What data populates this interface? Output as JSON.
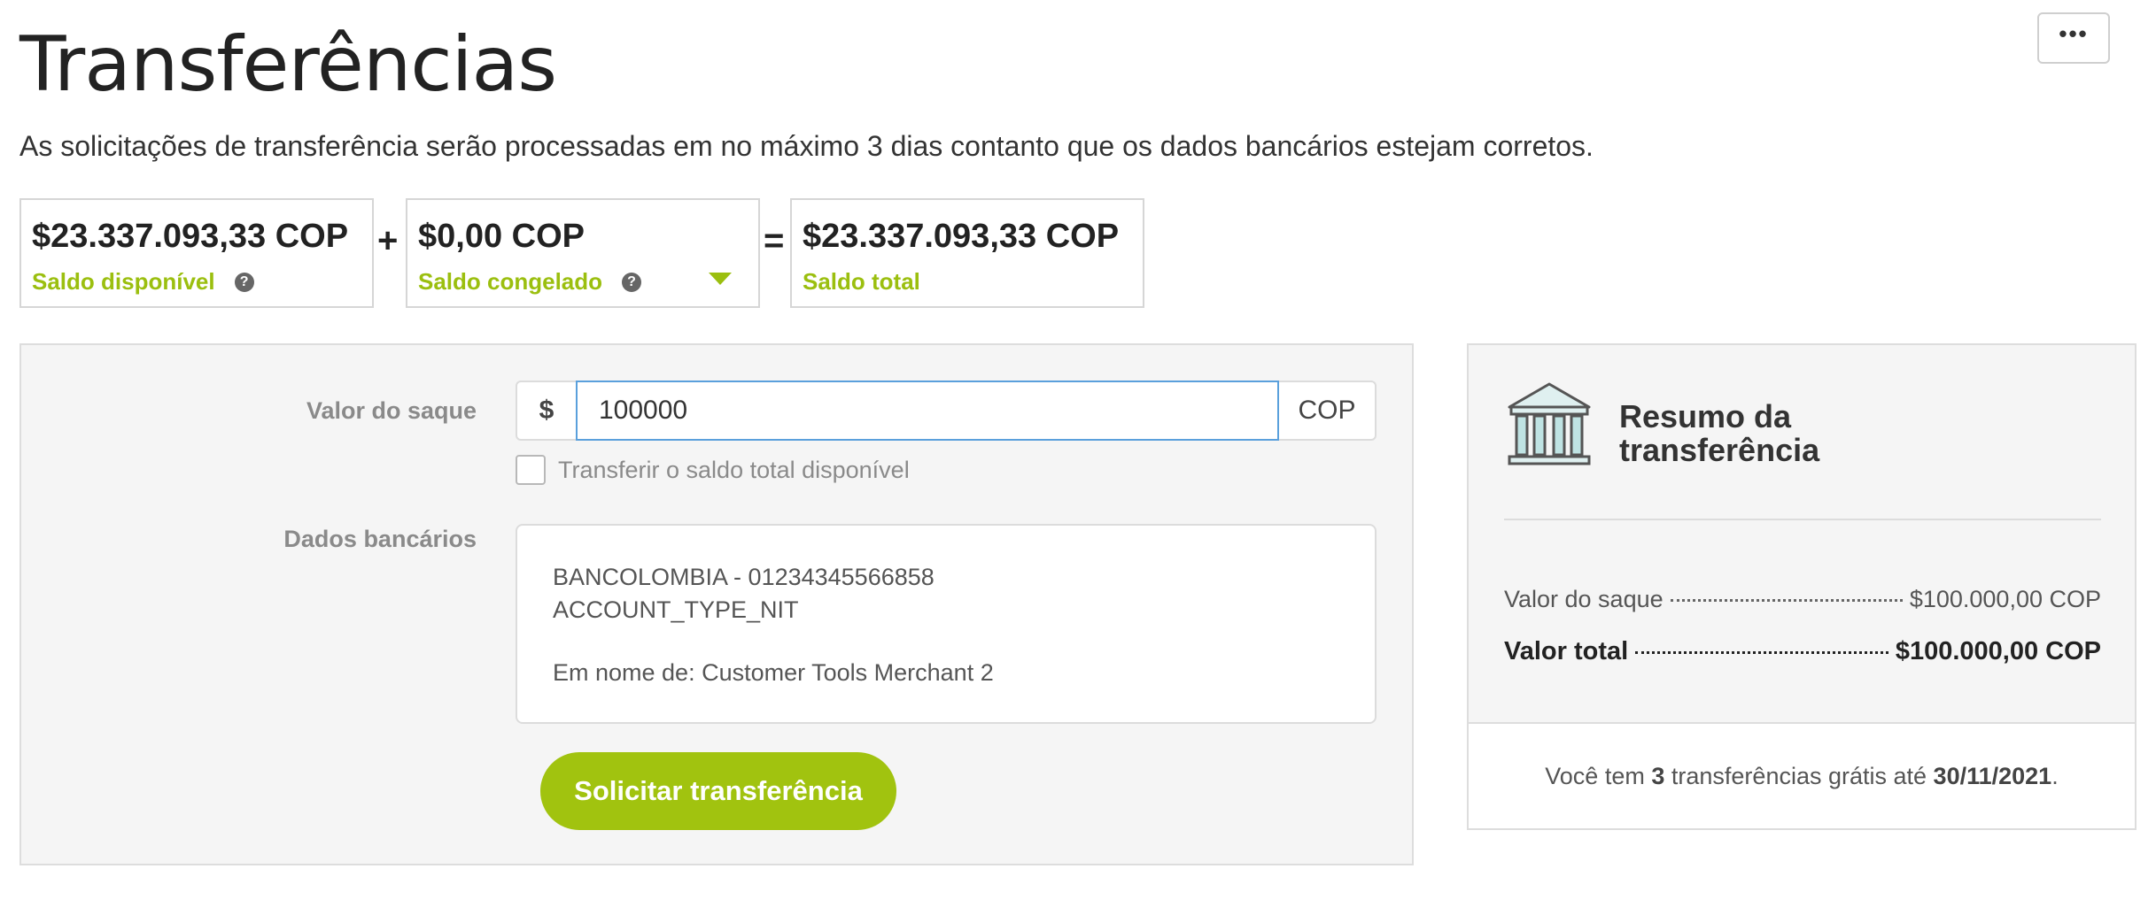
{
  "header": {
    "title": "Transferências",
    "subtitle": "As solicitações de transferência serão processadas em no máximo 3 dias contanto que os dados bancários estejam corretos.",
    "more_label": "•••"
  },
  "balances": {
    "available": {
      "amount": "$23.337.093,33 COP",
      "label": "Saldo disponível"
    },
    "plus": "+",
    "frozen": {
      "amount": "$0,00 COP",
      "label": "Saldo congelado"
    },
    "equals": "=",
    "total": {
      "amount": "$23.337.093,33 COP",
      "label": "Saldo total"
    },
    "help_glyph": "?"
  },
  "form": {
    "withdraw_label": "Valor do saque",
    "currency_prefix": "$",
    "amount_value": "100000",
    "currency_suffix": "COP",
    "checkbox_label": "Transferir o saldo total disponível",
    "checkbox_checked": false,
    "bank_label": "Dados bancários",
    "bank": {
      "line1": "BANCOLOMBIA - 01234345566858",
      "line2": "ACCOUNT_TYPE_NIT",
      "owner": "Em nome de: Customer Tools Merchant 2"
    },
    "submit_label": "Solicitar transferência"
  },
  "summary": {
    "title_line1": "Resumo da",
    "title_line2": "transferência",
    "rows": [
      {
        "label": "Valor do saque",
        "value": "$100.000,00 COP"
      },
      {
        "label": "Valor total",
        "value": "$100.000,00 COP"
      }
    ],
    "footer": {
      "prefix": "Você tem",
      "count": "3",
      "middle": "transferências grátis até",
      "date": "30/11/2021",
      "suffix": "."
    }
  },
  "colors": {
    "accent": "#a1c30f",
    "label_green": "#9bbf0f",
    "focus_border": "#5aa0dc"
  },
  "icons": {
    "more": "more-icon",
    "help": "help-icon",
    "caret": "caret-down-icon",
    "bank": "bank-building-icon"
  }
}
